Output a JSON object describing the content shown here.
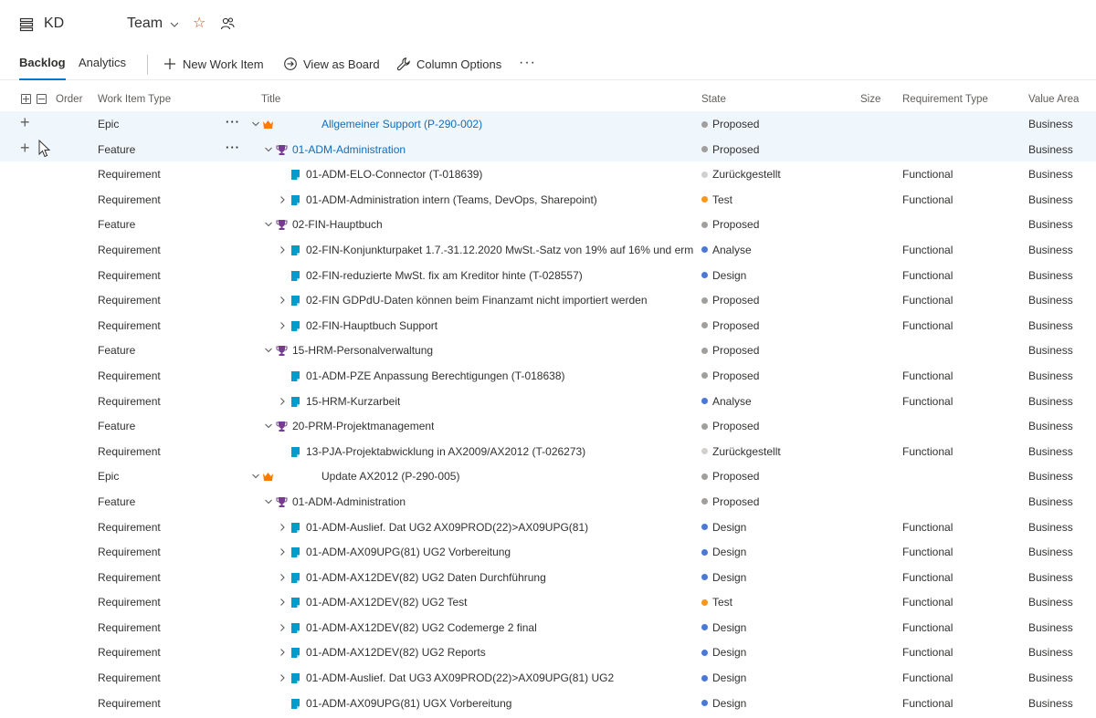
{
  "header": {
    "team_short": "KD",
    "team_name": "Team"
  },
  "toolbar": {
    "tabs": [
      {
        "label": "Backlog"
      },
      {
        "label": "Analytics"
      }
    ],
    "new_work_item": "New Work Item",
    "view_as_board": "View as Board",
    "column_options": "Column Options",
    "more": "···"
  },
  "columns": {
    "order": "Order",
    "work_item_type": "Work Item Type",
    "title": "Title",
    "state": "State",
    "size": "Size",
    "requirement_type": "Requirement Type",
    "value_area": "Value Area"
  },
  "colors": {
    "accent": "#0078d4",
    "proposed": "#a19f9d",
    "zurueckgestellt": "#d2d0ce",
    "test": "#f7971c",
    "blue_state": "#4a78d4",
    "epic": "#ff7b00",
    "feature": "#773b93",
    "requirement": "#009ccc"
  },
  "rows": [
    {
      "type": "Epic",
      "title": "Allgemeiner Support (P-290-002)",
      "state": "Proposed",
      "req_type": "",
      "value_area": "Business",
      "level": 0,
      "expand": "down",
      "icon": "crown-icon",
      "link": true,
      "selected": true,
      "add": true,
      "dots": true
    },
    {
      "type": "Feature",
      "title": "01-ADM-Administration",
      "state": "Proposed",
      "req_type": "",
      "value_area": "Business",
      "level": 1,
      "expand": "down",
      "icon": "trophy-icon",
      "link": true,
      "selected": true,
      "add": true,
      "dots": true,
      "cursor": true
    },
    {
      "type": "Requirement",
      "title": "01-ADM-ELO-Connector (T-018639)",
      "state": "Zurückgestellt",
      "req_type": "Functional",
      "value_area": "Business",
      "level": 2,
      "expand": "",
      "icon": "book-icon"
    },
    {
      "type": "Requirement",
      "title": "01-ADM-Administration intern (Teams, DevOps, Sharepoint)",
      "state": "Test",
      "req_type": "Functional",
      "value_area": "Business",
      "level": 2,
      "expand": "right",
      "icon": "book-icon"
    },
    {
      "type": "Feature",
      "title": "02-FIN-Hauptbuch",
      "state": "Proposed",
      "req_type": "",
      "value_area": "Business",
      "level": 1,
      "expand": "down",
      "icon": "trophy-icon"
    },
    {
      "type": "Requirement",
      "title": "02-FIN-Konjunkturpaket 1.7.-31.12.2020 MwSt.-Satz von 19% auf 16% und erm...",
      "state": "Analyse",
      "req_type": "Functional",
      "value_area": "Business",
      "level": 2,
      "expand": "right",
      "icon": "book-icon"
    },
    {
      "type": "Requirement",
      "title": "02-FIN-reduzierte MwSt. fix am Kreditor hinte (T-028557)",
      "state": "Design",
      "req_type": "Functional",
      "value_area": "Business",
      "level": 2,
      "expand": "",
      "icon": "book-icon"
    },
    {
      "type": "Requirement",
      "title": "02-FIN GDPdU-Daten können beim Finanzamt nicht importiert werden",
      "state": "Proposed",
      "req_type": "Functional",
      "value_area": "Business",
      "level": 2,
      "expand": "right",
      "icon": "book-icon"
    },
    {
      "type": "Requirement",
      "title": "02-FIN-Hauptbuch Support",
      "state": "Proposed",
      "req_type": "Functional",
      "value_area": "Business",
      "level": 2,
      "expand": "right",
      "icon": "book-icon"
    },
    {
      "type": "Feature",
      "title": "15-HRM-Personalverwaltung",
      "state": "Proposed",
      "req_type": "",
      "value_area": "Business",
      "level": 1,
      "expand": "down",
      "icon": "trophy-icon"
    },
    {
      "type": "Requirement",
      "title": "01-ADM-PZE Anpassung Berechtigungen (T-018638)",
      "state": "Proposed",
      "req_type": "Functional",
      "value_area": "Business",
      "level": 2,
      "expand": "",
      "icon": "book-icon"
    },
    {
      "type": "Requirement",
      "title": "15-HRM-Kurzarbeit",
      "state": "Analyse",
      "req_type": "Functional",
      "value_area": "Business",
      "level": 2,
      "expand": "right",
      "icon": "book-icon"
    },
    {
      "type": "Feature",
      "title": "20-PRM-Projektmanagement",
      "state": "Proposed",
      "req_type": "",
      "value_area": "Business",
      "level": 1,
      "expand": "down",
      "icon": "trophy-icon"
    },
    {
      "type": "Requirement",
      "title": "13-PJA-Projektabwicklung in AX2009/AX2012 (T-026273)",
      "state": "Zurückgestellt",
      "req_type": "Functional",
      "value_area": "Business",
      "level": 2,
      "expand": "",
      "icon": "book-icon"
    },
    {
      "type": "Epic",
      "title": "Update AX2012 (P-290-005)",
      "state": "Proposed",
      "req_type": "",
      "value_area": "Business",
      "level": 0,
      "expand": "down",
      "icon": "crown-icon"
    },
    {
      "type": "Feature",
      "title": "01-ADM-Administration",
      "state": "Proposed",
      "req_type": "",
      "value_area": "Business",
      "level": 1,
      "expand": "down",
      "icon": "trophy-icon"
    },
    {
      "type": "Requirement",
      "title": "01-ADM-Auslief. Dat UG2 AX09PROD(22)>AX09UPG(81)",
      "state": "Design",
      "req_type": "Functional",
      "value_area": "Business",
      "level": 2,
      "expand": "right",
      "icon": "book-icon"
    },
    {
      "type": "Requirement",
      "title": "01-ADM-AX09UPG(81) UG2 Vorbereitung",
      "state": "Design",
      "req_type": "Functional",
      "value_area": "Business",
      "level": 2,
      "expand": "right",
      "icon": "book-icon"
    },
    {
      "type": "Requirement",
      "title": "01-ADM-AX12DEV(82) UG2 Daten Durchführung",
      "state": "Design",
      "req_type": "Functional",
      "value_area": "Business",
      "level": 2,
      "expand": "right",
      "icon": "book-icon"
    },
    {
      "type": "Requirement",
      "title": "01-ADM-AX12DEV(82) UG2 Test",
      "state": "Test",
      "req_type": "Functional",
      "value_area": "Business",
      "level": 2,
      "expand": "right",
      "icon": "book-icon"
    },
    {
      "type": "Requirement",
      "title": "01-ADM-AX12DEV(82) UG2 Codemerge 2 final",
      "state": "Design",
      "req_type": "Functional",
      "value_area": "Business",
      "level": 2,
      "expand": "right",
      "icon": "book-icon"
    },
    {
      "type": "Requirement",
      "title": "01-ADM-AX12DEV(82) UG2 Reports",
      "state": "Design",
      "req_type": "Functional",
      "value_area": "Business",
      "level": 2,
      "expand": "right",
      "icon": "book-icon"
    },
    {
      "type": "Requirement",
      "title": "01-ADM-Auslief. Dat UG3 AX09PROD(22)>AX09UPG(81) UG2",
      "state": "Design",
      "req_type": "Functional",
      "value_area": "Business",
      "level": 2,
      "expand": "right",
      "icon": "book-icon"
    },
    {
      "type": "Requirement",
      "title": "01-ADM-AX09UPG(81) UGX Vorbereitung",
      "state": "Design",
      "req_type": "Functional",
      "value_area": "Business",
      "level": 2,
      "expand": "",
      "icon": "book-icon"
    }
  ]
}
